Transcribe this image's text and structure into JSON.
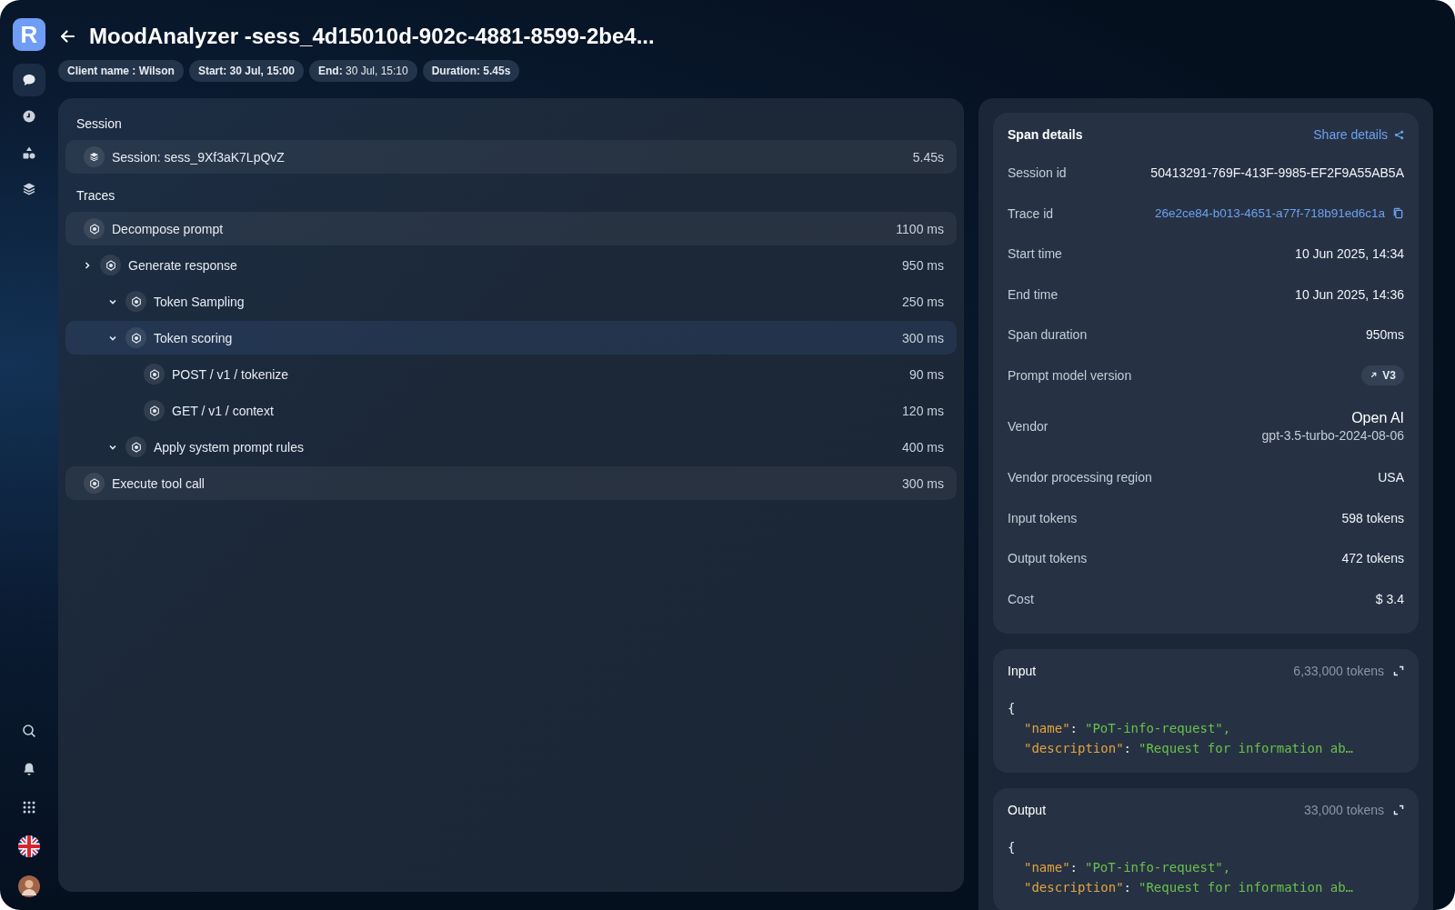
{
  "logo": "R",
  "nav_items": [
    {
      "kind": "chat",
      "selected": true
    },
    {
      "kind": "clock",
      "selected": false
    },
    {
      "kind": "shapes",
      "selected": false
    },
    {
      "kind": "layers",
      "selected": false
    }
  ],
  "header": {
    "title": "MoodAnalyzer -sess_4d15010d-902c-4881-8599-2be4...",
    "chips": [
      {
        "text": "Client name : Wilson",
        "strong": true
      },
      {
        "text": "Start: 30 Jul, 15:00",
        "strong": true
      },
      {
        "text": "**End:** 30 Jul, 15:10",
        "strong": false
      },
      {
        "text": "Duration: 5.45s",
        "strong": true
      }
    ]
  },
  "session": {
    "heading": "Session",
    "label": "Session: sess_9Xf3aK7LpQvZ",
    "duration": "5.45s"
  },
  "traces": {
    "heading": "Traces",
    "items": [
      {
        "label": "Decompose prompt",
        "duration": "1100 ms",
        "highlighted": true
      },
      {
        "label": "Generate response",
        "duration": "950 ms",
        "highlighted": false,
        "expanded": false,
        "children": [
          {
            "label": "Token Sampling",
            "duration": "250 ms",
            "highlighted": false,
            "expanded": true
          },
          {
            "label": "Token scoring",
            "duration": "300 ms",
            "highlighted": true,
            "expanded": true,
            "children": [
              {
                "label": "POST / v1 / tokenize",
                "duration": "90 ms",
                "highlighted": false
              },
              {
                "label": "GET / v1 / context",
                "duration": "120 ms",
                "highlighted": false
              }
            ]
          },
          {
            "label": "Apply system prompt rules",
            "duration": "400 ms",
            "highlighted": false,
            "expanded": true
          }
        ]
      },
      {
        "label": "Execute tool call",
        "duration": "300 ms",
        "highlighted": true
      }
    ]
  },
  "span_details": {
    "title": "Span details",
    "share": "Share details",
    "rows": [
      {
        "kind": "text",
        "label": "Session id",
        "value": "50413291-769F-413F-9985-EF2F9A55AB5A"
      },
      {
        "kind": "link",
        "label": "Trace id",
        "value": "26e2ce84-b013-4651-a77f-718b91ed6c1a"
      },
      {
        "kind": "text",
        "label": "Start time",
        "value": "10 Jun 2025, 14:34"
      },
      {
        "kind": "text",
        "label": "End time",
        "value": "10 Jun 2025, 14:36"
      },
      {
        "kind": "text",
        "label": "Span duration",
        "value": "950ms"
      },
      {
        "kind": "badge",
        "label": "Prompt model version",
        "value": "V3"
      },
      {
        "kind": "vendor",
        "label": "Vendor",
        "value": "Open AI",
        "sub": "gpt-3.5-turbo-2024-08-06"
      },
      {
        "kind": "text",
        "label": "Vendor processing region",
        "value": "USA"
      },
      {
        "kind": "text",
        "label": "Input tokens",
        "value": "598 tokens"
      },
      {
        "kind": "text",
        "label": "Output tokens",
        "value": "472 tokens"
      },
      {
        "kind": "text",
        "label": "Cost",
        "value": "$ 3.4"
      }
    ]
  },
  "io": [
    {
      "title": "Input",
      "tokens": "6,33,000 tokens",
      "open": "{",
      "entries": [
        {
          "key": "\"name\"",
          "sep": ":",
          "value": "\"PoT-info-request\","
        },
        {
          "key": "\"description\"",
          "sep": ":",
          "value": "\"Request for information ab…"
        }
      ]
    },
    {
      "title": "Output",
      "tokens": "33,000 tokens",
      "open": "{",
      "entries": [
        {
          "key": "\"name\"",
          "sep": ":",
          "value": "\"PoT-info-request\","
        },
        {
          "key": "\"description\"",
          "sep": ":",
          "value": "\"Request for information ab…"
        }
      ]
    }
  ]
}
